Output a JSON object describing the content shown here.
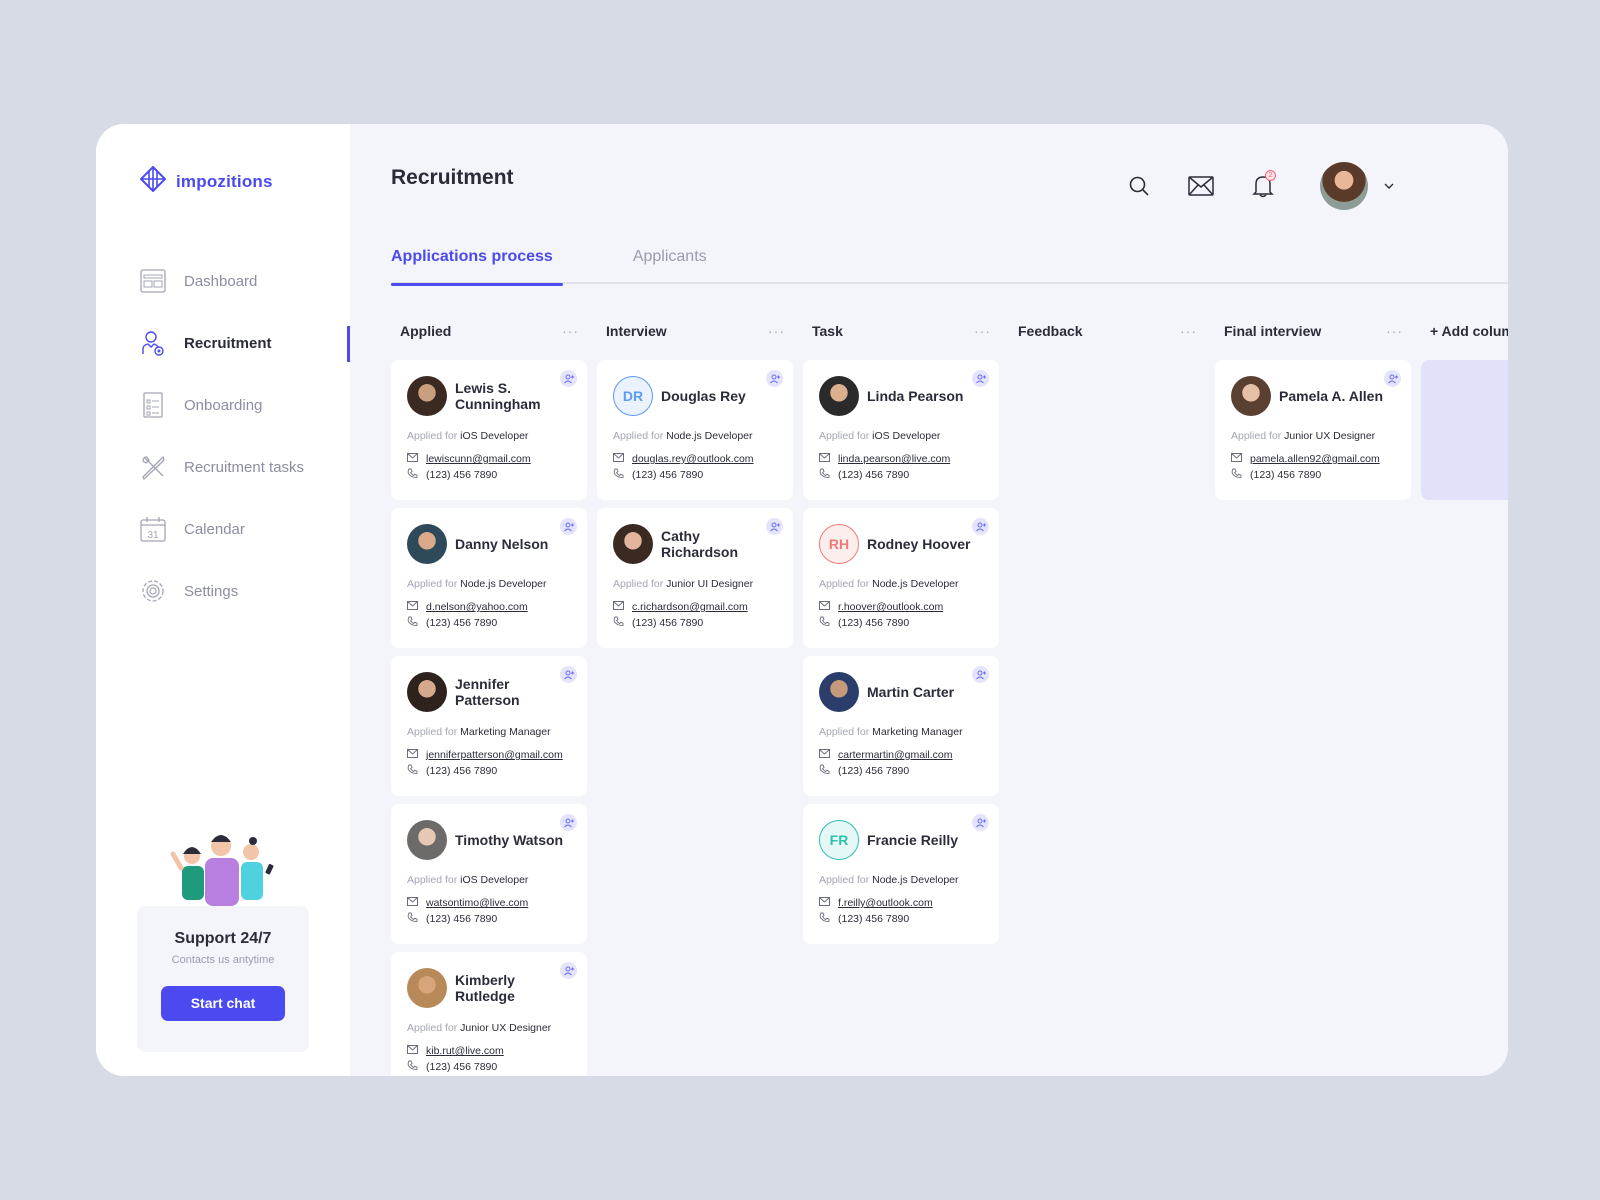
{
  "app": {
    "brand": "impozitions",
    "accent": "#4a4af0"
  },
  "sidebar": {
    "items": [
      {
        "label": "Dashboard",
        "icon": "dashboard-icon",
        "active": false
      },
      {
        "label": "Recruitment",
        "icon": "recruiter-icon",
        "active": true
      },
      {
        "label": "Onboarding",
        "icon": "checklist-icon",
        "active": false
      },
      {
        "label": "Recruitment tasks",
        "icon": "tools-icon",
        "active": false
      },
      {
        "label": "Calendar",
        "icon": "calendar-icon",
        "active": false,
        "icon_text": "31"
      },
      {
        "label": "Settings",
        "icon": "gear-icon",
        "active": false
      }
    ],
    "support": {
      "title": "Support 24/7",
      "subtitle": "Contacts us antytime",
      "button": "Start chat"
    }
  },
  "header": {
    "title": "Recruitment",
    "notifications_count": "2"
  },
  "tabs": [
    {
      "label": "Applications process",
      "active": true
    },
    {
      "label": "Applicants",
      "active": false
    }
  ],
  "board": {
    "applied_prefix": "Applied for",
    "more_label": "···",
    "add_column_label": "+ Add column",
    "add_plus": "+",
    "columns": [
      {
        "title": "Applied",
        "cards": [
          {
            "name": "Lewis S. Cunningham",
            "role": "iOS Developer",
            "email": "lewiscunn@gmail.com",
            "phone": "(123) 456 7890",
            "avatar": "photo"
          },
          {
            "name": "Danny Nelson",
            "role": "Node.js Developer",
            "email": "d.nelson@yahoo.com",
            "phone": "(123) 456 7890",
            "avatar": "photo"
          },
          {
            "name": "Jennifer Patterson",
            "role": "Marketing Manager",
            "email": "jenniferpatterson@gmail.com",
            "phone": "(123) 456 7890",
            "avatar": "photo"
          },
          {
            "name": "Timothy Watson",
            "role": "iOS Developer",
            "email": "watsontimo@live.com",
            "phone": "(123) 456 7890",
            "avatar": "photo"
          },
          {
            "name": "Kimberly Rutledge",
            "role": "Junior UX Designer",
            "email": "kib.rut@live.com",
            "phone": "(123) 456 7890",
            "avatar": "photo"
          }
        ]
      },
      {
        "title": "Interview",
        "cards": [
          {
            "name": "Douglas Rey",
            "role": "Node.js Developer",
            "email": "douglas.rey@outlook.com",
            "phone": "(123) 456 7890",
            "avatar": "initials",
            "initials": "DR",
            "color": "#5b9bf0",
            "bg": "#eaf2fe"
          },
          {
            "name": "Cathy Richardson",
            "role": "Junior UI Designer",
            "email": "c.richardson@gmail.com",
            "phone": "(123) 456 7890",
            "avatar": "photo"
          }
        ]
      },
      {
        "title": "Task",
        "cards": [
          {
            "name": "Linda Pearson",
            "role": "iOS Developer",
            "email": "linda.pearson@live.com",
            "phone": "(123) 456 7890",
            "avatar": "photo"
          },
          {
            "name": "Rodney Hoover",
            "role": "Node.js Developer",
            "email": "r.hoover@outlook.com",
            "phone": "(123) 456 7890",
            "avatar": "initials",
            "initials": "RH",
            "color": "#f07a7a",
            "bg": "#fdeeee"
          },
          {
            "name": "Martin Carter",
            "role": "Marketing Manager",
            "email": "cartermartin@gmail.com",
            "phone": "(123) 456 7890",
            "avatar": "photo"
          },
          {
            "name": "Francie Reilly",
            "role": "Node.js Developer",
            "email": "f.reilly@outlook.com",
            "phone": "(123) 456 7890",
            "avatar": "initials",
            "initials": "FR",
            "color": "#2cc2b0",
            "bg": "#e6f8f5"
          }
        ]
      },
      {
        "title": "Feedback",
        "cards": []
      },
      {
        "title": "Final interview",
        "cards": [
          {
            "name": "Pamela A. Allen",
            "role": "Junior UX Designer",
            "email": "pamela.allen92@gmail.com",
            "phone": "(123) 456 7890",
            "avatar": "photo"
          }
        ]
      }
    ]
  }
}
